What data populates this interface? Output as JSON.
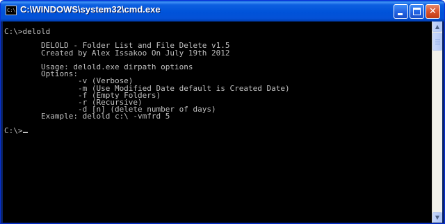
{
  "window": {
    "title": "C:\\WINDOWS\\system32\\cmd.exe",
    "icon": "cmd-icon",
    "icon_text": "C:\\"
  },
  "titlebar_buttons": {
    "minimize": "minimize-icon",
    "maximize": "maximize-icon",
    "close": "close-icon",
    "close_glyph": "✕"
  },
  "console": {
    "text": "C:\\>delold\n\n        DELOLD - Folder List and File Delete v1.5\n        Created by Alex Issakoo On July 19th 2012\n\n        Usage: delold.exe dirpath options\n        Options:\n                -v (Verbose)\n                -m (Use Modified Date default is Created Date)\n                -f (Empty Folders)\n                -r (Recursive)\n                -d [n] (delete number of days)\n        Example: delold c:\\ -vmfrd 5\n\nC:\\>"
  },
  "scrollbar": {
    "up_glyph": "▲",
    "down_glyph": "▼"
  },
  "colors": {
    "console_bg": "#000000",
    "console_fg": "#c0c0c0",
    "titlebar": "#0053d9",
    "close_button": "#d9532c"
  }
}
